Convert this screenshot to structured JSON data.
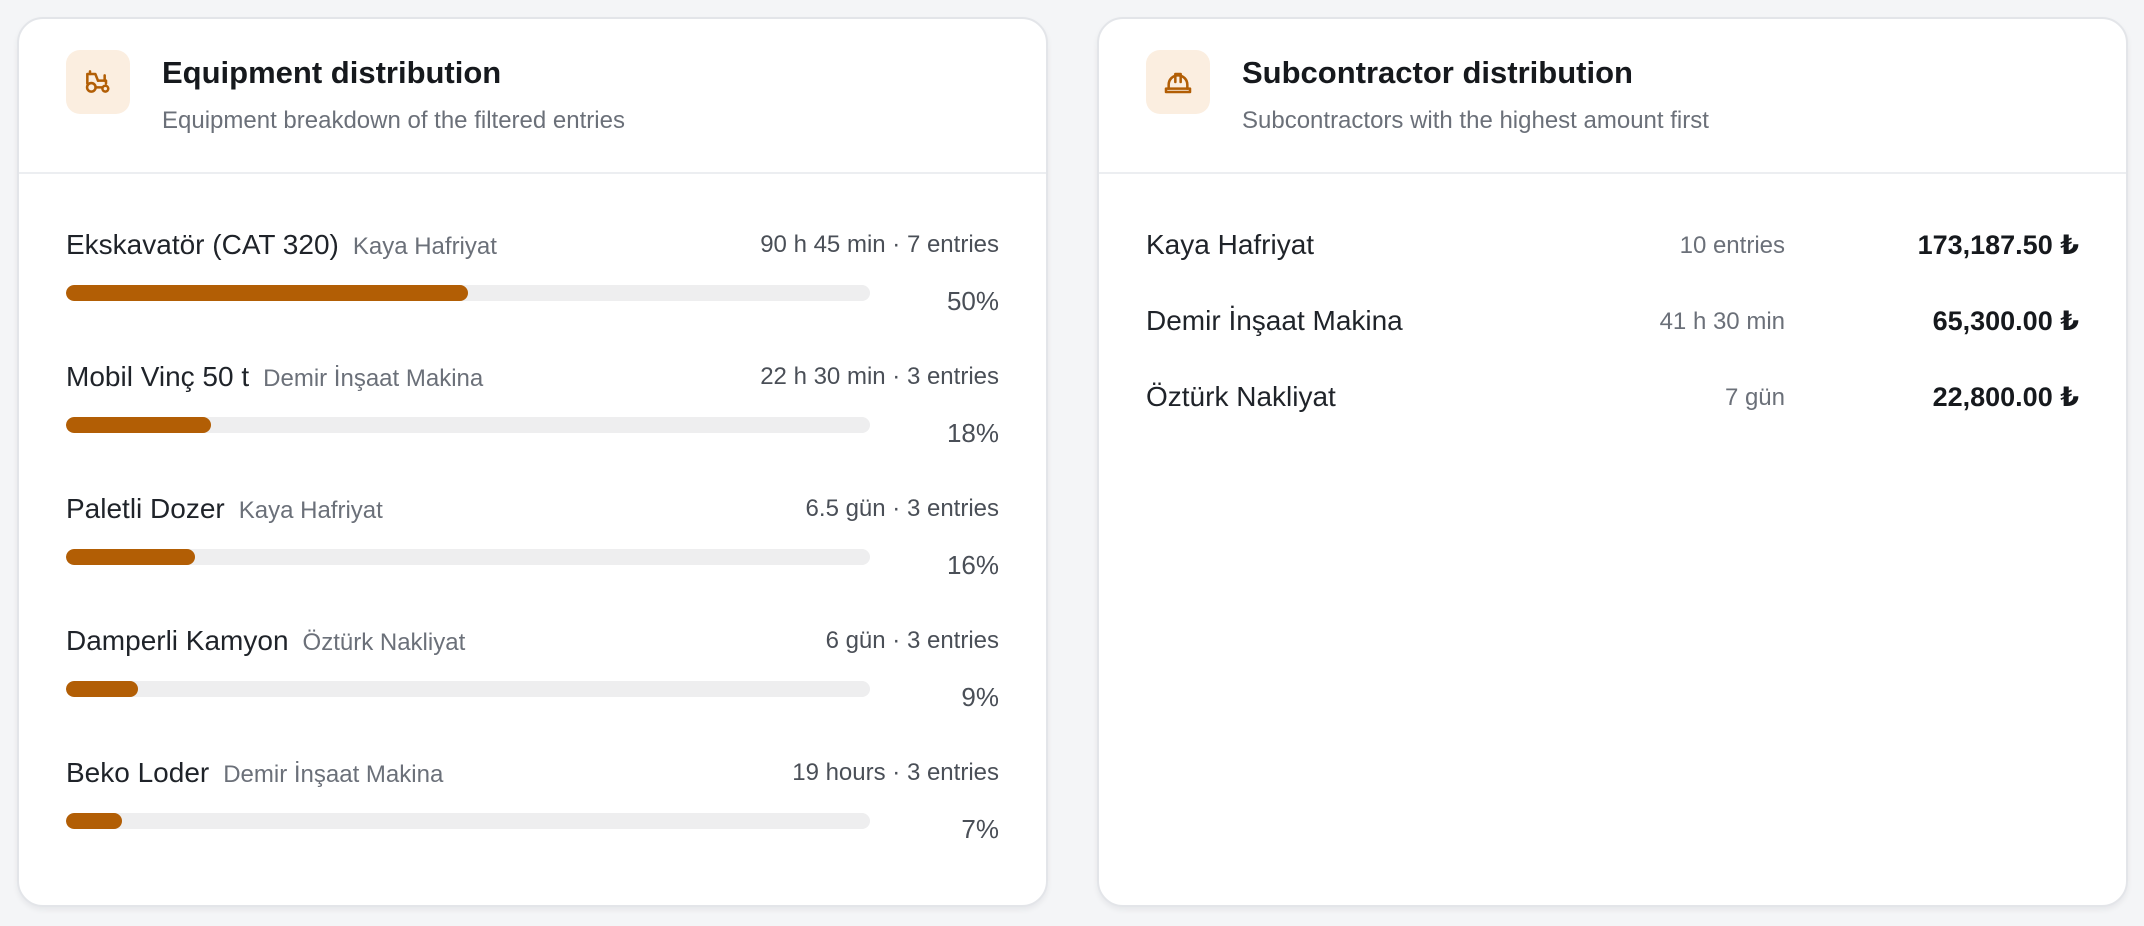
{
  "colors": {
    "accent": "#b25e05",
    "icon_bg": "#fbeee0",
    "track": "#eeeeef"
  },
  "equipment": {
    "icon": "tractor-icon",
    "title": "Equipment distribution",
    "subtitle": "Equipment breakdown of the filtered entries",
    "items": [
      {
        "name": "Ekskavatör (CAT 320)",
        "subcontractor": "Kaya Hafriyat",
        "meta": "90 h 45 min · 7 entries",
        "percent_label": "50%",
        "percent": 50
      },
      {
        "name": "Mobil Vinç 50 t",
        "subcontractor": "Demir İnşaat Makina",
        "meta": "22 h 30 min · 3 entries",
        "percent_label": "18%",
        "percent": 18
      },
      {
        "name": "Paletli Dozer",
        "subcontractor": "Kaya Hafriyat",
        "meta": "6.5 gün · 3 entries",
        "percent_label": "16%",
        "percent": 16
      },
      {
        "name": "Damperli Kamyon",
        "subcontractor": "Öztürk Nakliyat",
        "meta": "6 gün · 3 entries",
        "percent_label": "9%",
        "percent": 9
      },
      {
        "name": "Beko Loder",
        "subcontractor": "Demir İnşaat Makina",
        "meta": "19 hours · 3 entries",
        "percent_label": "7%",
        "percent": 7
      }
    ]
  },
  "subcontractors": {
    "icon": "hard-hat-icon",
    "title": "Subcontractor distribution",
    "subtitle": "Subcontractors with the highest amount first",
    "items": [
      {
        "name": "Kaya Hafriyat",
        "count": "10 entries",
        "amount": "173,187.50 ₺"
      },
      {
        "name": "Demir İnşaat Makina",
        "count": "41 h 30 min",
        "amount": "65,300.00 ₺"
      },
      {
        "name": "Öztürk Nakliyat",
        "count": "7 gün",
        "amount": "22,800.00 ₺"
      }
    ]
  }
}
